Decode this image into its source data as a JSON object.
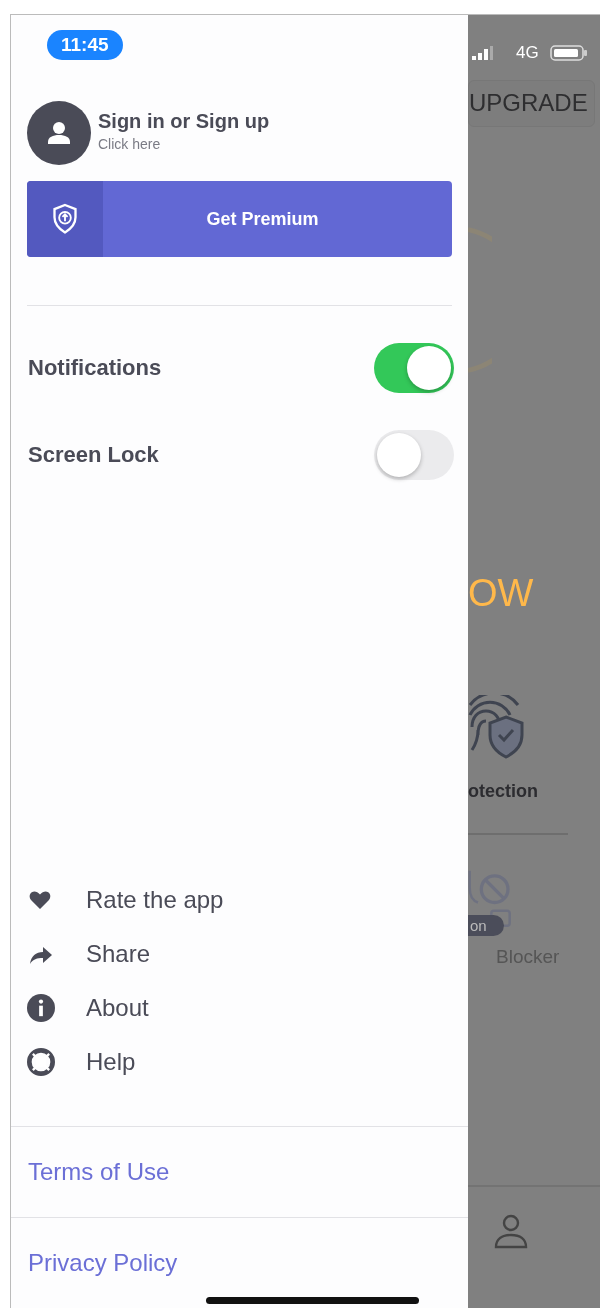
{
  "status_bar": {
    "time": "11:45",
    "network": "4G"
  },
  "drawer": {
    "account": {
      "title": "Sign in or Sign up",
      "subtitle": "Click here"
    },
    "premium_button": "Get Premium",
    "settings": [
      {
        "label": "Notifications",
        "on": true
      },
      {
        "label": "Screen Lock",
        "on": false
      }
    ],
    "menu": [
      {
        "label": "Rate the app",
        "kind": "heart"
      },
      {
        "label": "Share",
        "kind": "share"
      },
      {
        "label": "About",
        "kind": "info"
      },
      {
        "label": "Help",
        "kind": "help"
      }
    ],
    "links": [
      "Terms of Use",
      "Privacy Policy"
    ]
  },
  "background": {
    "upgrade_button": "UPGRADE",
    "heading": "OW",
    "feature_1": "otection",
    "badge": "on",
    "feature_2": "Blocker"
  }
}
